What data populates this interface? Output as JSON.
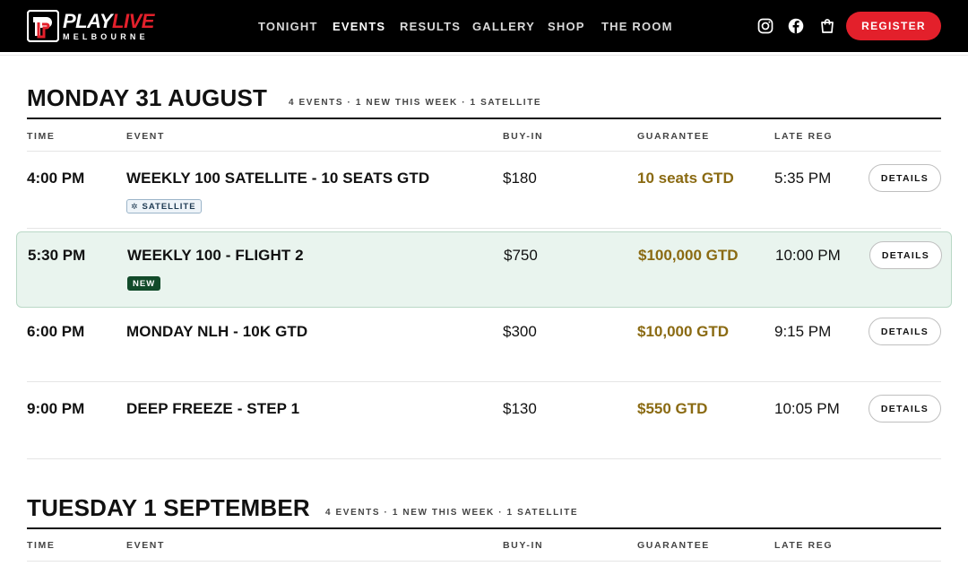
{
  "brand": {
    "name_part1": "PLAY",
    "name_part2": "LIVE",
    "subtitle": "MELBOURNE",
    "accent_color": "#e3202b"
  },
  "nav": {
    "items": [
      "TONIGHT",
      "EVENTS",
      "RESULTS",
      "GALLERY",
      "SHOP",
      "THE ROOM"
    ],
    "active": "EVENTS"
  },
  "header_icons": [
    "instagram-icon",
    "facebook-icon",
    "cart-icon"
  ],
  "register_label": "REGISTER",
  "columns": {
    "time": "TIME",
    "event": "EVENT",
    "buyin": "BUY-IN",
    "guarantee": "GUARANTEE",
    "late_reg": "LATE REG"
  },
  "details_label": "DETAILS",
  "badges": {
    "satellite": "SATELLITE",
    "new": "NEW"
  },
  "days": [
    {
      "title": "MONDAY 31 AUGUST",
      "meta": "4 EVENTS · 1 NEW THIS WEEK · 1 SATELLITE",
      "events": [
        {
          "time": "4:00 PM",
          "name": "WEEKLY 100 SATELLITE - 10 SEATS GTD",
          "buyin": "$180",
          "guarantee": "10 seats GTD",
          "late_reg": "5:35 PM",
          "badge": "satellite",
          "highlighted": false
        },
        {
          "time": "5:30 PM",
          "name": "WEEKLY 100 - FLIGHT 2",
          "buyin": "$750",
          "guarantee": "$100,000 GTD",
          "late_reg": "10:00 PM",
          "badge": "new",
          "highlighted": true
        },
        {
          "time": "6:00 PM",
          "name": "MONDAY NLH - 10K GTD",
          "buyin": "$300",
          "guarantee": "$10,000 GTD",
          "late_reg": "9:15 PM",
          "badge": null,
          "highlighted": false
        },
        {
          "time": "9:00 PM",
          "name": "DEEP FREEZE - STEP 1",
          "buyin": "$130",
          "guarantee": "$550 GTD",
          "late_reg": "10:05 PM",
          "badge": null,
          "highlighted": false
        }
      ]
    },
    {
      "title": "TUESDAY 1 SEPTEMBER",
      "meta": "4 EVENTS · 1 NEW THIS WEEK · 1 SATELLITE",
      "events": []
    }
  ],
  "colors": {
    "guarantee": "#8a6a12",
    "highlight_bg": "#e9f4ee",
    "new_badge": "#124b2a"
  }
}
